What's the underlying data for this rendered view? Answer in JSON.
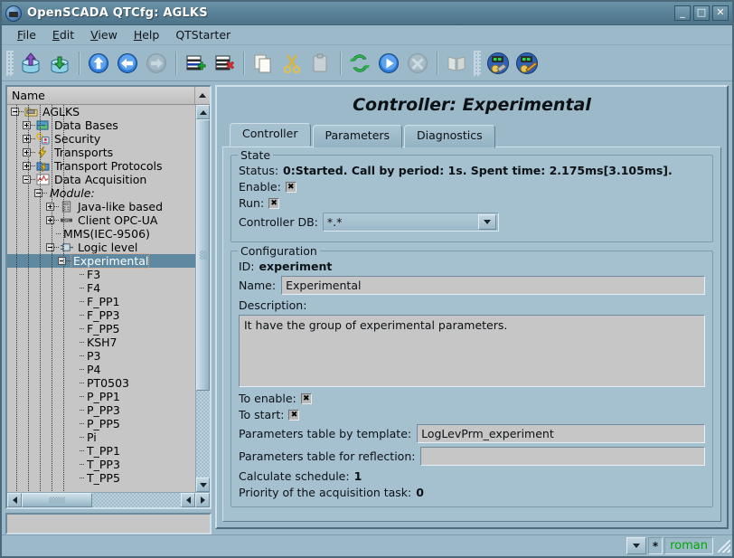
{
  "window": {
    "title": "OpenSCADA QTCfg: AGLKS",
    "icon": "app-icon",
    "buttons": {
      "minimize": "_",
      "maximize": "□",
      "close": "✕"
    }
  },
  "menubar": {
    "items": [
      {
        "label": "File",
        "mnemonic": "F"
      },
      {
        "label": "Edit",
        "mnemonic": "E"
      },
      {
        "label": "View",
        "mnemonic": "V"
      },
      {
        "label": "Help",
        "mnemonic": "H"
      },
      {
        "label": "QTStarter",
        "mnemonic": ""
      }
    ]
  },
  "toolbar": {
    "buttons": [
      {
        "name": "load-from-db-icon",
        "tip": "Load from DB"
      },
      {
        "name": "save-to-db-icon",
        "tip": "Save to DB"
      },
      {
        "name": "go-up-icon",
        "tip": "Up"
      },
      {
        "name": "go-back-icon",
        "tip": "Previous"
      },
      {
        "name": "go-forward-icon",
        "tip": "Next"
      },
      {
        "name": "add-node-icon",
        "tip": "Add node"
      },
      {
        "name": "delete-node-icon",
        "tip": "Delete node"
      },
      {
        "name": "copy-icon",
        "tip": "Copy"
      },
      {
        "name": "cut-icon",
        "tip": "Cut"
      },
      {
        "name": "paste-icon",
        "tip": "Paste"
      },
      {
        "name": "refresh-icon",
        "tip": "Refresh"
      },
      {
        "name": "start-icon",
        "tip": "Start"
      },
      {
        "name": "stop-icon",
        "tip": "Stop"
      },
      {
        "name": "manual-icon",
        "tip": "Manual"
      },
      {
        "name": "config-user-icon",
        "tip": "Configuration"
      },
      {
        "name": "config-edit-icon",
        "tip": "Edit configuration"
      }
    ]
  },
  "tree": {
    "header": "Name",
    "selected": "Experimental",
    "items": [
      {
        "label": "AGLKS",
        "depth": 0,
        "expander": "minus",
        "icon": "folder-station-icon",
        "italic": false
      },
      {
        "label": "Data Bases",
        "depth": 1,
        "expander": "plus",
        "icon": "database-icon",
        "italic": false
      },
      {
        "label": "Security",
        "depth": 1,
        "expander": "plus",
        "icon": "key-user-icon",
        "italic": false
      },
      {
        "label": "Transports",
        "depth": 1,
        "expander": "plus",
        "icon": "bolt-icon",
        "italic": false
      },
      {
        "label": "Transport Protocols",
        "depth": 1,
        "expander": "plus",
        "icon": "folder-bolt-icon",
        "italic": false
      },
      {
        "label": "Data Acquisition",
        "depth": 1,
        "expander": "minus",
        "icon": "chart-icon",
        "italic": false
      },
      {
        "label": "Module:",
        "depth": 2,
        "expander": "minus",
        "icon": "",
        "italic": true
      },
      {
        "label": "Java-like based",
        "depth": 3,
        "expander": "plus",
        "icon": "module-icon",
        "italic": false
      },
      {
        "label": "Client OPC-UA",
        "depth": 3,
        "expander": "plus",
        "icon": "opc-icon",
        "italic": false
      },
      {
        "label": "MMS(IEC-9506)",
        "depth": 3,
        "expander": "none",
        "icon": "",
        "italic": false
      },
      {
        "label": "Logic level",
        "depth": 3,
        "expander": "minus",
        "icon": "logic-icon",
        "italic": false
      },
      {
        "label": "Experimental",
        "depth": 4,
        "expander": "minus",
        "icon": "",
        "italic": false,
        "selected": true
      },
      {
        "label": "F3",
        "depth": 5,
        "expander": "none",
        "icon": "",
        "italic": false
      },
      {
        "label": "F4",
        "depth": 5,
        "expander": "none",
        "icon": "",
        "italic": false
      },
      {
        "label": "F_PP1",
        "depth": 5,
        "expander": "none",
        "icon": "",
        "italic": false
      },
      {
        "label": "F_PP3",
        "depth": 5,
        "expander": "none",
        "icon": "",
        "italic": false
      },
      {
        "label": "F_PP5",
        "depth": 5,
        "expander": "none",
        "icon": "",
        "italic": false
      },
      {
        "label": "KSH7",
        "depth": 5,
        "expander": "none",
        "icon": "",
        "italic": false
      },
      {
        "label": "P3",
        "depth": 5,
        "expander": "none",
        "icon": "",
        "italic": false
      },
      {
        "label": "P4",
        "depth": 5,
        "expander": "none",
        "icon": "",
        "italic": false
      },
      {
        "label": "PT0503",
        "depth": 5,
        "expander": "none",
        "icon": "",
        "italic": false
      },
      {
        "label": "P_PP1",
        "depth": 5,
        "expander": "none",
        "icon": "",
        "italic": false
      },
      {
        "label": "P_PP3",
        "depth": 5,
        "expander": "none",
        "icon": "",
        "italic": false
      },
      {
        "label": "P_PP5",
        "depth": 5,
        "expander": "none",
        "icon": "",
        "italic": false
      },
      {
        "label": "Pi",
        "depth": 5,
        "expander": "none",
        "icon": "",
        "italic": false
      },
      {
        "label": "T_PP1",
        "depth": 5,
        "expander": "none",
        "icon": "",
        "italic": false
      },
      {
        "label": "T_PP3",
        "depth": 5,
        "expander": "none",
        "icon": "",
        "italic": false
      },
      {
        "label": "T_PP5",
        "depth": 5,
        "expander": "none",
        "icon": "",
        "italic": false
      }
    ],
    "status_text": ""
  },
  "main": {
    "title": "Controller: Experimental",
    "tabs": [
      {
        "label": "Controller",
        "active": true
      },
      {
        "label": "Parameters",
        "active": false
      },
      {
        "label": "Diagnostics",
        "active": false
      }
    ],
    "state": {
      "legend": "State",
      "status_label": "Status:",
      "status_value": "0:Started. Call by period: 1s. Spent time: 2.175ms[3.105ms].",
      "enable_label": "Enable:",
      "enable_checked": true,
      "run_label": "Run:",
      "run_checked": true,
      "controller_db_label": "Controller DB:",
      "controller_db_value": "*.*"
    },
    "configuration": {
      "legend": "Configuration",
      "id_label": "ID:",
      "id_value": "experiment",
      "name_label": "Name:",
      "name_value": "Experimental",
      "description_label": "Description:",
      "description_value": "It have the group of experimental parameters.",
      "to_enable_label": "To enable:",
      "to_enable_checked": true,
      "to_start_label": "To start:",
      "to_start_checked": true,
      "params_table_template_label": "Parameters table by template:",
      "params_table_template_value": "LogLevPrm_experiment",
      "params_table_reflection_label": "Parameters table for reflection:",
      "params_table_reflection_value": "",
      "calculate_schedule_label": "Calculate schedule:",
      "calculate_schedule_value": "1",
      "priority_label": "Priority of the acquisition task:",
      "priority_value": "0"
    }
  },
  "statusbar": {
    "star": "*",
    "user": "roman",
    "user_color": "#00a800"
  }
}
